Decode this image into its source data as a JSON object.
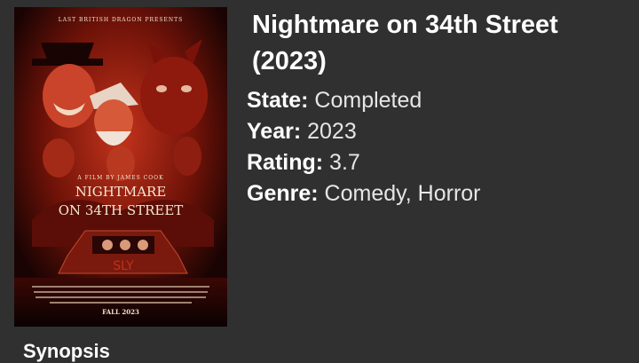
{
  "poster": {
    "presenter": "LAST BRITISH DRAGON PRESENTS",
    "credit": "A FILM BY JAMES COOK",
    "title_line1": "NIGHTMARE",
    "title_line2": "ON 34TH STREET",
    "plate": "SLY",
    "date": "FALL 2023"
  },
  "movie": {
    "title": "Nightmare on 34th Street (2023)",
    "fields": [
      {
        "label": "State:",
        "value": " Completed"
      },
      {
        "label": "Year:",
        "value": " 2023"
      },
      {
        "label": "Rating:",
        "value": " 3.7"
      },
      {
        "label": "Genre:",
        "value": " Comedy, Horror"
      }
    ]
  },
  "section": {
    "synopsis_heading": "Synopsis"
  },
  "colors": {
    "background": "#303030",
    "poster_red": "#b3200f"
  }
}
